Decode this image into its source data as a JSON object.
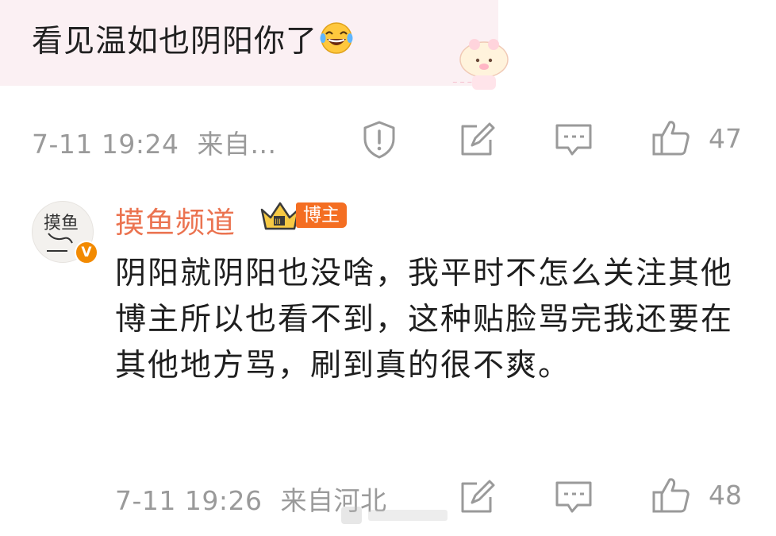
{
  "comment1": {
    "text": "看见温如也阴阳你了",
    "emoji_icon": "laugh-cry-emoji-icon",
    "time": "7-11 19:24",
    "source": "来自...",
    "likes": "47",
    "icons": [
      "report-icon",
      "repost-icon",
      "comment-icon",
      "like-icon"
    ]
  },
  "comment2": {
    "username": "摸鱼频道",
    "badge": "博主",
    "verified_icon": "verified-v-icon",
    "crown_icon": "crown-icon",
    "avatar_text": "摸鱼",
    "text": "阴阳就阴阳也没啥，我平时不怎么关注其他博主所以也看不到，这种贴脸骂完我还要在其他地方骂，刷到真的很不爽。",
    "time": "7-11 19:26",
    "source": "来自河北",
    "likes": "48",
    "icons": [
      "repost-icon",
      "comment-icon",
      "like-icon"
    ]
  },
  "colors": {
    "username": "#eb7350",
    "badge_bg": "#f46e22",
    "meta_gray": "#9a9a9a",
    "bubble_bg": "#fbf0f3"
  }
}
